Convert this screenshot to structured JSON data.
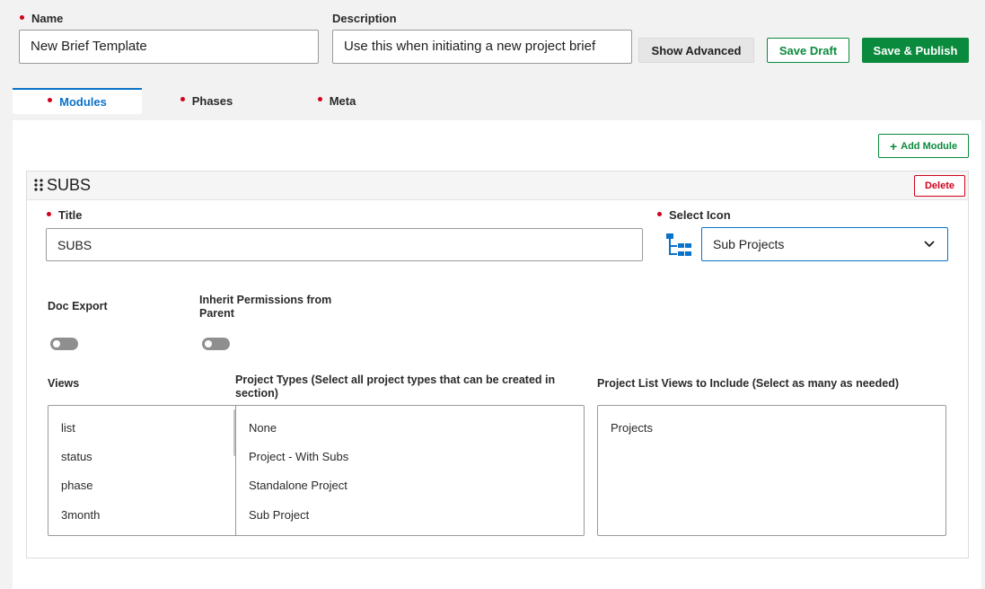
{
  "header": {
    "name_label": "Name",
    "name_value": "New Brief Template",
    "description_label": "Description",
    "description_value": "Use this when initiating a new project brief",
    "show_advanced_label": "Show Advanced",
    "save_draft_label": "Save Draft",
    "save_publish_label": "Save & Publish"
  },
  "tabs": [
    {
      "label": "Modules",
      "active": true
    },
    {
      "label": "Phases",
      "active": false
    },
    {
      "label": "Meta",
      "active": false
    }
  ],
  "add_module_label": "Add Module",
  "module": {
    "heading": "SUBS",
    "delete_label": "Delete",
    "title_label": "Title",
    "title_value": "SUBS",
    "select_icon_label": "Select Icon",
    "select_icon_value": "Sub Projects",
    "doc_export_label": "Doc Export",
    "doc_export_on": false,
    "inherit_label_line1": "Inherit Permissions from",
    "inherit_label_line2": "Parent",
    "inherit_on": false,
    "views_label": "Views",
    "views": [
      "list",
      "status",
      "phase",
      "3month"
    ],
    "project_types_label_line1": "Project Types (Select all project types that can be created in",
    "project_types_label_line2": "section)",
    "project_types": [
      "None",
      "Project - With Subs",
      "Standalone Project",
      "Sub Project"
    ],
    "list_views_label": "Project List Views to Include (Select as many as needed)",
    "list_views": [
      "Projects"
    ]
  },
  "colors": {
    "accent_blue": "#0a72c9",
    "brand_green": "#0a8a3c",
    "required_red": "#d0021b"
  }
}
